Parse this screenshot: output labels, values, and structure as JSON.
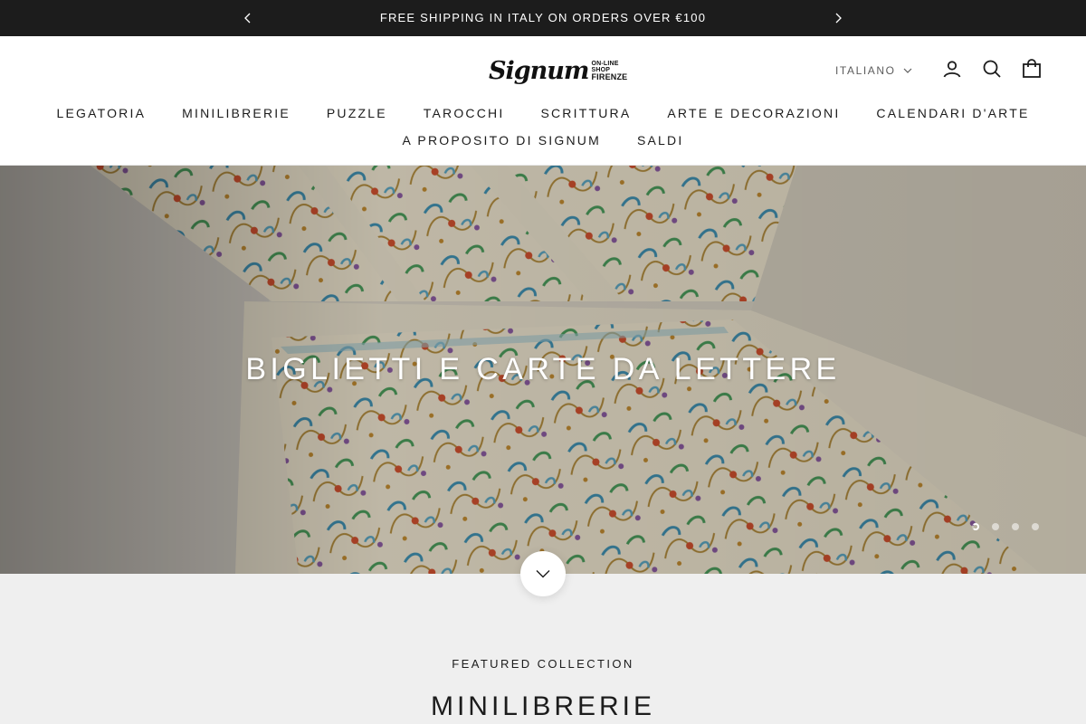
{
  "announcement": {
    "text": "FREE SHIPPING IN ITALY ON ORDERS OVER €100",
    "prev_icon": "chevron-left-icon",
    "next_icon": "chevron-right-icon"
  },
  "header": {
    "logo": {
      "main": "Signum",
      "side_top": "ON-LINE SHOP",
      "side_bottom": "FIRENZE"
    },
    "language": {
      "selected": "ITALIANO",
      "icon": "chevron-down-icon"
    },
    "icons": [
      "account-icon",
      "search-icon",
      "cart-icon"
    ]
  },
  "nav": {
    "row1": [
      "LEGATORIA",
      "MINILIBRERIE",
      "PUZZLE",
      "TAROCCHI",
      "SCRITTURA",
      "ARTE E DECORAZIONI",
      "CALENDARI D'ARTE"
    ],
    "row2": [
      "A PROPOSITO DI SIGNUM",
      "SALDI"
    ]
  },
  "hero": {
    "title": "BIGLIETTI E CARTE DA LETTERE",
    "slides_total": 4,
    "active_slide": 1
  },
  "featured": {
    "subtitle": "FEATURED COLLECTION",
    "title": "MINILIBRERIE"
  },
  "colors": {
    "announcement_bg": "#1c1c1c",
    "text": "#1c1c1c",
    "featured_bg": "#efefef",
    "hero_paper": "#efe7d4"
  }
}
